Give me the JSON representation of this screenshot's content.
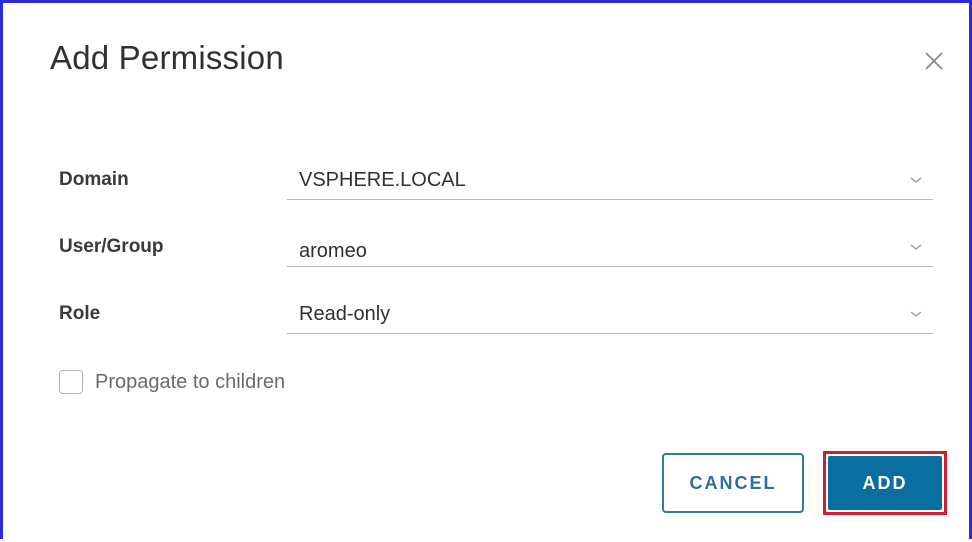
{
  "dialog": {
    "title": "Add Permission",
    "close_icon": "close-icon"
  },
  "form": {
    "domain": {
      "label": "Domain",
      "value": "VSPHERE.LOCAL"
    },
    "user_group": {
      "label": "User/Group",
      "value": "aromeo"
    },
    "role": {
      "label": "Role",
      "value": "Read-only"
    },
    "propagate": {
      "label": "Propagate to children",
      "checked": false
    }
  },
  "buttons": {
    "cancel_label": "CANCEL",
    "add_label": "ADD"
  },
  "colors": {
    "primary": "#0b6ea0",
    "highlight_outline": "#d01f2d",
    "window_border": "#2b2bdc"
  }
}
